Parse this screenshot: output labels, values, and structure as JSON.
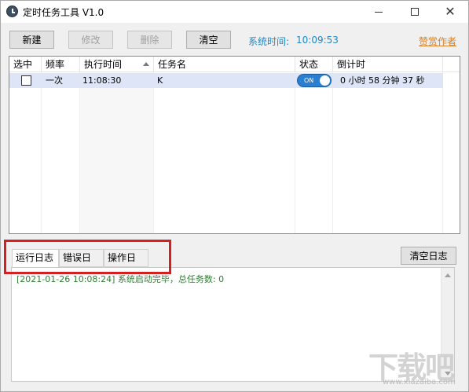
{
  "window": {
    "title": "定时任务工具 V1.0",
    "icons": {
      "app": "clock-app-icon",
      "minimize": "minimize-icon",
      "maximize": "maximize-icon",
      "close": "close-icon"
    },
    "close_glyph": "✕"
  },
  "toolbar": {
    "new_label": "新建",
    "edit_label": "修改",
    "delete_label": "删除",
    "clear_label": "清空",
    "systime_label": "系统时间:",
    "systime_value": "10:09:53",
    "sponsor_label": "赞赏作者"
  },
  "colors": {
    "accent": "#1e88c8",
    "sponsor": "#d9822b",
    "row_selected": "#dde5f6",
    "toggle_on": "#2a7fd0",
    "log_text": "#2e7d32",
    "highlight": "#d42020"
  },
  "table": {
    "columns": [
      "选中",
      "频率",
      "执行时间",
      "任务名",
      "状态",
      "倒计时"
    ],
    "sort_column": "执行时间",
    "sort_direction": "ascending",
    "rows": [
      {
        "selected": false,
        "frequency": "一次",
        "time": "11:08:30",
        "name": "K",
        "status": "ON",
        "status_on": true,
        "countdown": "0 小时 58 分钟 37 秒"
      }
    ]
  },
  "log": {
    "tabs": [
      "运行日志",
      "错误日志",
      "操作日志"
    ],
    "active_tab": "运行日志",
    "clear_label": "清空日志",
    "lines": [
      "[2021-01-26 10:08:24] 系统启动完毕，总任务数: 0"
    ]
  },
  "watermark": {
    "main": "下载吧",
    "sub": "www.xiazaiba.com"
  }
}
